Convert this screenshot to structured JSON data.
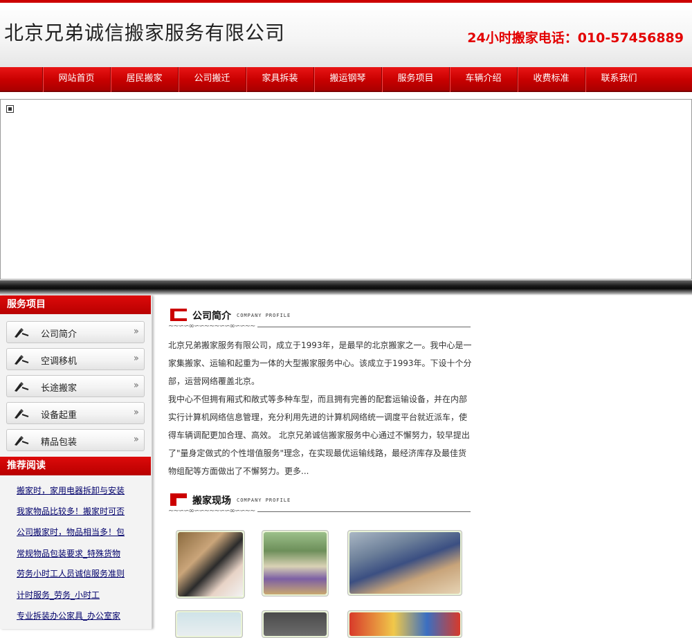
{
  "header": {
    "site_title": "北京兄弟诚信搬家服务有限公司",
    "hotline": "24小时搬家电话：010-57456889"
  },
  "nav": {
    "items": [
      "网站首页",
      "居民搬家",
      "公司搬迁",
      "家具拆装",
      "搬运钢琴",
      "服务项目",
      "车辆介绍",
      "收费标准",
      "联系我们"
    ]
  },
  "sidebar": {
    "services_title": "服务项目",
    "services": [
      "公司简介",
      "空调移机",
      "长途搬家",
      "设备起重",
      "精品包装"
    ],
    "reading_title": "推荐阅读",
    "reading": [
      "搬家时，家用电器拆卸与安装",
      "我家物品比较多！搬家时可否",
      "公司搬家时，物品相当多！包",
      "常规物品包装要求_特殊货物",
      "劳务小时工人员诚信服务准则",
      "计时服务_劳务_小时工",
      "专业拆装办公家具_办公室家"
    ]
  },
  "profile": {
    "title": "公司简介",
    "subtitle": "COMPANY PROFILE",
    "text": "北京兄弟搬家服务有限公司，成立于1993年，是最早的北京搬家之一。我中心是一家集搬家、运输和起重为一体的大型搬家服务中心。该成立于1993年。下设十个分部，运营网络覆盖北京。",
    "text2": "我中心不但拥有厢式和敞式等多种车型，而且拥有完善的配套运输设备，并在内部实行计算机网络信息管理，充分利用先进的计算机网络统一调度平台就近派车，使得车辆调配更加合理、高效。  北京兄弟诚信搬家服务中心通过不懈努力，较早提出了\"量身定做式的个性增值服务\"理念，在实现最优运输线路，最经济库存及最佳货物组配等方面做出了不懈努力。更多..."
  },
  "scene": {
    "title": "搬家现场",
    "subtitle": "COMPANY PROFILE"
  },
  "colors": {
    "brand_red": "#cc0000",
    "hotline_red": "#e30000",
    "link_blue": "#00006b"
  }
}
